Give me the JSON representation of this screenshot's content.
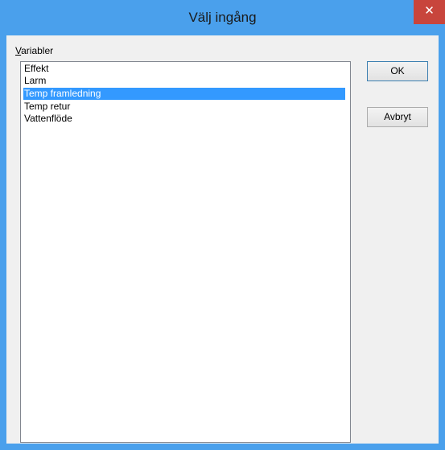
{
  "window": {
    "title": "Välj ingång",
    "close_glyph": "✕"
  },
  "group": {
    "label_accel": "V",
    "label_rest": "ariabler"
  },
  "list": {
    "items": [
      {
        "label": "Effekt",
        "selected": false
      },
      {
        "label": "Larm",
        "selected": false
      },
      {
        "label": "Temp framledning",
        "selected": true
      },
      {
        "label": "Temp retur",
        "selected": false
      },
      {
        "label": "Vattenflöde",
        "selected": false
      }
    ]
  },
  "buttons": {
    "ok_label": "OK",
    "cancel_label": "Avbryt"
  },
  "colors": {
    "frame": "#4aa0ec",
    "close": "#c8453c",
    "selection": "#3399ff"
  },
  "icons": {
    "close": "close-icon"
  }
}
